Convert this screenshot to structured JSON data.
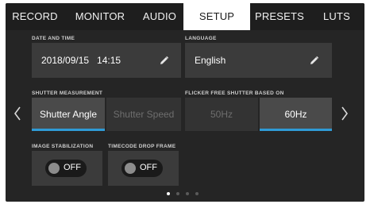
{
  "tabs": [
    {
      "label": "RECORD",
      "active": false
    },
    {
      "label": "MONITOR",
      "active": false
    },
    {
      "label": "AUDIO",
      "active": false
    },
    {
      "label": "SETUP",
      "active": true
    },
    {
      "label": "PRESETS",
      "active": false
    },
    {
      "label": "LUTS",
      "active": false
    }
  ],
  "date_time": {
    "label": "DATE AND TIME",
    "value": "2018/09/15   14:15",
    "edit_icon": "pencil-icon"
  },
  "language": {
    "label": "LANGUAGE",
    "value": "English",
    "edit_icon": "pencil-icon"
  },
  "shutter_measurement": {
    "label": "SHUTTER MEASUREMENT",
    "options": [
      "Shutter Angle",
      "Shutter Speed"
    ],
    "selected": "Shutter Angle"
  },
  "flicker_free": {
    "label": "FLICKER FREE SHUTTER BASED ON",
    "options": [
      "50Hz",
      "60Hz"
    ],
    "selected": "60Hz"
  },
  "image_stabilization": {
    "label": "IMAGE STABILIZATION",
    "state": "OFF"
  },
  "timecode_drop_frame": {
    "label": "TIMECODE DROP FRAME",
    "state": "OFF"
  },
  "pagination": {
    "pages": 4,
    "current": 1
  },
  "colors": {
    "accent": "#2f9bd6",
    "tab_active_bg": "#ffffff",
    "background": "#252525"
  },
  "icons": {
    "prev": "chevron-left-icon",
    "next": "chevron-right-icon",
    "edit": "pencil-icon"
  }
}
